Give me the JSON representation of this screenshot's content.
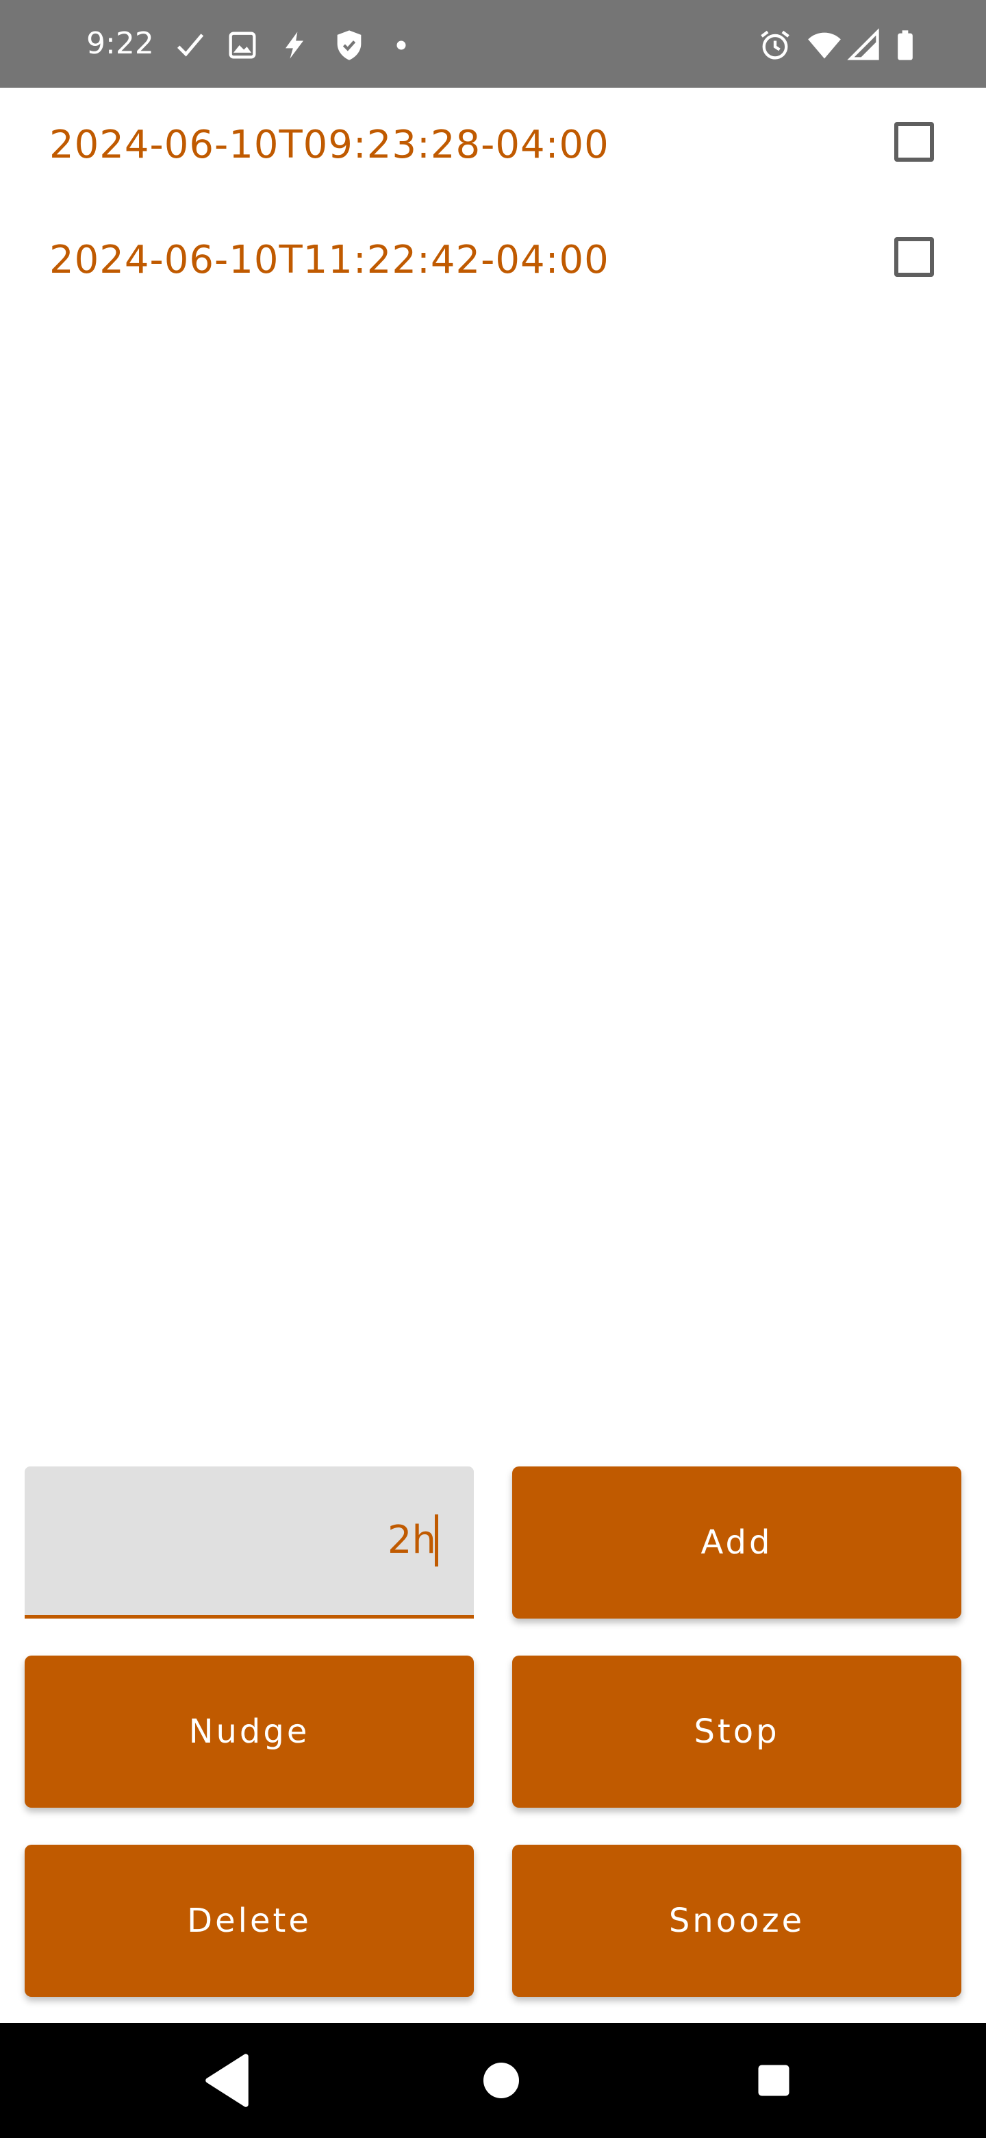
{
  "status_bar": {
    "time": "9:22",
    "left_icons": [
      "check-icon",
      "image-icon",
      "lightning-icon",
      "shield-icon",
      "dot-icon"
    ],
    "right_icons": [
      "alarm-icon",
      "wifi-icon",
      "signal-icon",
      "battery-icon"
    ]
  },
  "list": {
    "items": [
      {
        "label": "2024-06-10T09:23:28-04:00",
        "checked": false
      },
      {
        "label": "2024-06-10T11:22:42-04:00",
        "checked": false
      }
    ]
  },
  "controls": {
    "duration_value": "2h",
    "add_label": "Add",
    "nudge_label": "Nudge",
    "stop_label": "Stop",
    "delete_label": "Delete",
    "snooze_label": "Snooze"
  },
  "nav_bar": {
    "buttons": [
      "back-icon",
      "home-icon",
      "recents-icon"
    ]
  },
  "colors": {
    "accent": "#c05a00",
    "status_bar_bg": "#757575",
    "input_bg": "#e0e0e0",
    "nav_bar_bg": "#000000"
  }
}
